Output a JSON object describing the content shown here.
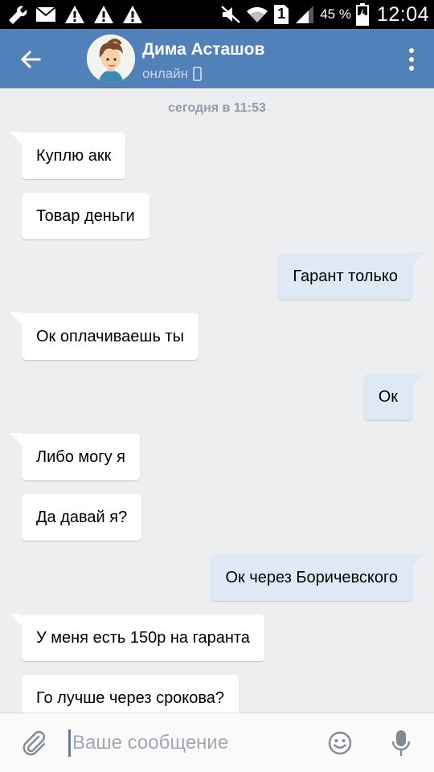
{
  "status_bar": {
    "battery_percent": "45 %",
    "clock": "12:04",
    "sim_slot": "1",
    "icons": [
      "wrench-icon",
      "mail-icon",
      "warning-icon",
      "warning-icon",
      "warning-icon",
      "mute-icon",
      "wifi-icon",
      "sim-icon",
      "signal-icon",
      "battery-icon"
    ]
  },
  "header": {
    "contact_name": "Дима Асташов",
    "status": "онлайн",
    "icons": [
      "back-arrow-icon",
      "mobile-phone-icon",
      "more-vertical-icon"
    ]
  },
  "chat": {
    "date_separator": "сегодня в 11:53",
    "messages": [
      {
        "text": "Куплю акк",
        "dir": "in"
      },
      {
        "text": "Товар деньги",
        "dir": "in"
      },
      {
        "text": "Гарант только",
        "dir": "out"
      },
      {
        "text": "Ок оплачиваешь ты",
        "dir": "in"
      },
      {
        "text": "Ок",
        "dir": "out"
      },
      {
        "text": "Либо могу я",
        "dir": "in"
      },
      {
        "text": "Да давай я?",
        "dir": "in"
      },
      {
        "text": "Ок через Боричевского",
        "dir": "out"
      },
      {
        "text": "У меня есть 150р на гаранта",
        "dir": "in"
      },
      {
        "text": "Го лучше через срокова?",
        "dir": "in"
      }
    ]
  },
  "compose": {
    "placeholder": "Ваше сообщение",
    "value": "",
    "icons": [
      "paperclip-icon",
      "emoji-icon",
      "microphone-icon"
    ]
  },
  "colors": {
    "header_bg": "#5181b8",
    "chat_bg": "#edeef0",
    "incoming_bubble": "#ffffff",
    "outgoing_bubble": "#dfe8f5",
    "status_bar_bg": "#000000"
  }
}
